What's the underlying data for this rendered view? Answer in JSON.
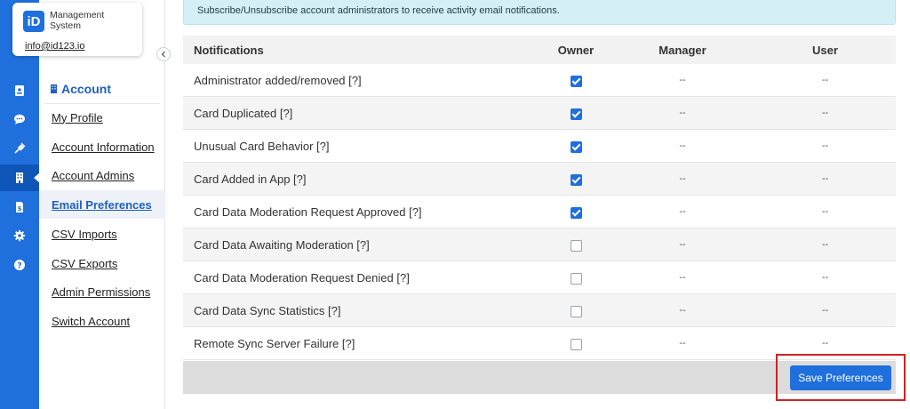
{
  "brand": {
    "badge": "iD",
    "name": "Management System",
    "email": "info@id123.io"
  },
  "rail": {
    "icons": [
      "id-card-icon",
      "chat-icon",
      "plug-icon",
      "building-icon",
      "file-dollar-icon",
      "gear-icon",
      "help-icon"
    ],
    "active_index": 3
  },
  "nav": {
    "section_title": "Account",
    "items": [
      {
        "label": "My Profile"
      },
      {
        "label": "Account Information"
      },
      {
        "label": "Account Admins"
      },
      {
        "label": "Email Preferences"
      },
      {
        "label": "CSV Imports"
      },
      {
        "label": "CSV Exports"
      },
      {
        "label": "Admin Permissions"
      },
      {
        "label": "Switch Account"
      }
    ],
    "active_index": 3
  },
  "banner": {
    "text": "Subscribe/Unsubscribe account administrators to receive activity email notifications."
  },
  "table": {
    "headers": {
      "notifications": "Notifications",
      "owner": "Owner",
      "manager": "Manager",
      "user": "User"
    },
    "rows": [
      {
        "name": "Administrator added/removed [?]",
        "owner": true,
        "manager": "--",
        "user": "--"
      },
      {
        "name": "Card Duplicated [?]",
        "owner": true,
        "manager": "--",
        "user": "--"
      },
      {
        "name": "Unusual Card Behavior [?]",
        "owner": true,
        "manager": "--",
        "user": "--"
      },
      {
        "name": "Card Added in App [?]",
        "owner": true,
        "manager": "--",
        "user": "--"
      },
      {
        "name": "Card Data Moderation Request Approved [?]",
        "owner": true,
        "manager": "--",
        "user": "--"
      },
      {
        "name": "Card Data Awaiting Moderation [?]",
        "owner": false,
        "manager": "--",
        "user": "--"
      },
      {
        "name": "Card Data Moderation Request Denied [?]",
        "owner": false,
        "manager": "--",
        "user": "--"
      },
      {
        "name": "Card Data Sync Statistics [?]",
        "owner": false,
        "manager": "--",
        "user": "--"
      },
      {
        "name": "Remote Sync Server Failure [?]",
        "owner": false,
        "manager": "--",
        "user": "--"
      }
    ]
  },
  "actions": {
    "save_label": "Save Preferences"
  },
  "colors": {
    "primary": "#1f6fdd",
    "rail_active": "#0f55b8",
    "banner_bg": "#d4f0f6",
    "highlight": "#d02222"
  }
}
